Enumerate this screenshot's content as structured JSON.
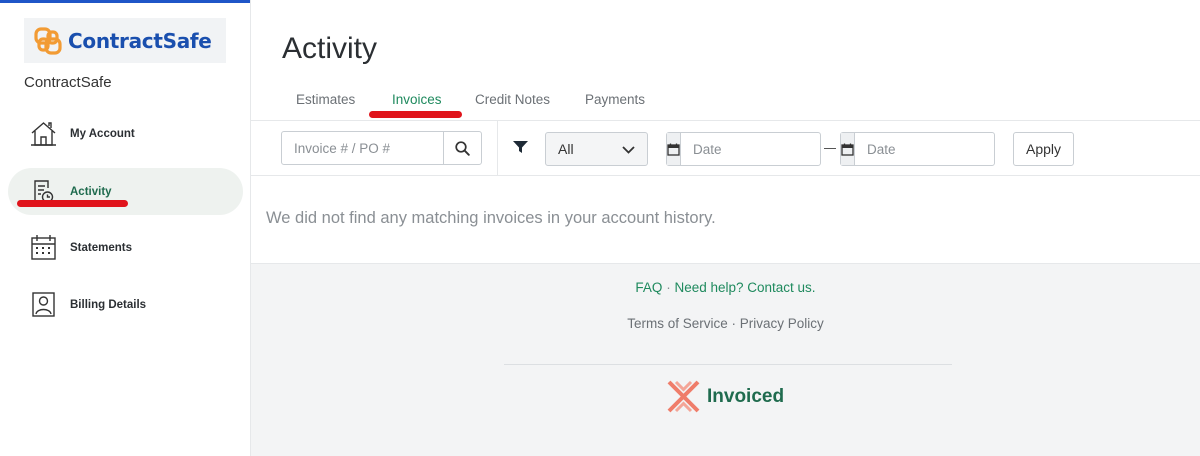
{
  "sidebar": {
    "logo_text": "ContractSafe",
    "company_name": "ContractSafe",
    "items": [
      {
        "label": "My Account",
        "icon": "home-icon",
        "active": false
      },
      {
        "label": "Activity",
        "icon": "activity-document-icon",
        "active": true
      },
      {
        "label": "Statements",
        "icon": "calendar-icon",
        "active": false
      },
      {
        "label": "Billing Details",
        "icon": "user-card-icon",
        "active": false
      }
    ]
  },
  "main": {
    "title": "Activity",
    "tabs": [
      {
        "label": "Estimates",
        "active": false
      },
      {
        "label": "Invoices",
        "active": true
      },
      {
        "label": "Credit Notes",
        "active": false
      },
      {
        "label": "Payments",
        "active": false
      }
    ],
    "filters": {
      "search_placeholder": "Invoice # / PO #",
      "status_value": "All",
      "date_from_placeholder": "Date",
      "date_to_placeholder": "Date",
      "apply_label": "Apply"
    },
    "empty_message": "We did not find any matching invoices in your account history."
  },
  "footer": {
    "faq": "FAQ",
    "separator": "·",
    "help": "Need help? Contact us.",
    "terms": "Terms of Service",
    "privacy": "Privacy Policy",
    "brand": "Invoiced"
  },
  "colors": {
    "accent_green": "#1f8a5e",
    "brand_blue": "#1a4fae",
    "logo_orange": "#f29b34",
    "annotation_red": "#e0141b",
    "invoiced_salmon": "#ef7d6a"
  }
}
